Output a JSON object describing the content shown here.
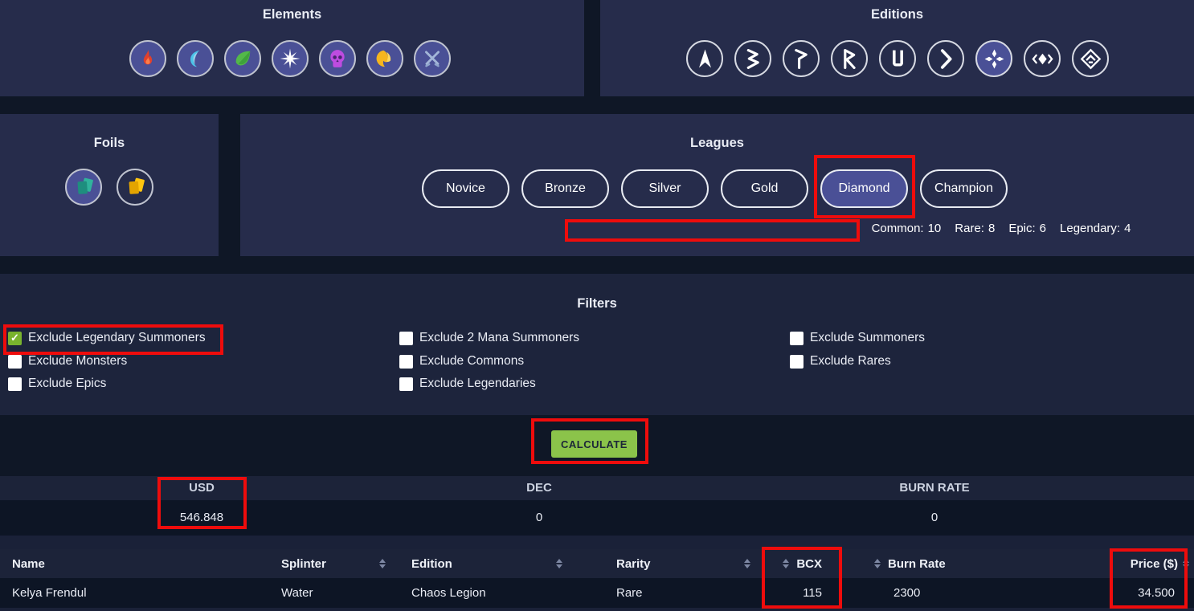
{
  "elements_panel": {
    "title": "Elements",
    "items": [
      {
        "name": "fire",
        "selected": true
      },
      {
        "name": "water",
        "selected": true
      },
      {
        "name": "earth",
        "selected": true
      },
      {
        "name": "life",
        "selected": true
      },
      {
        "name": "death",
        "selected": true
      },
      {
        "name": "dragon",
        "selected": true
      },
      {
        "name": "neutral",
        "selected": true
      }
    ]
  },
  "editions_panel": {
    "title": "Editions",
    "items": [
      {
        "name": "alpha",
        "selected": false
      },
      {
        "name": "beta",
        "selected": false
      },
      {
        "name": "promo",
        "selected": false
      },
      {
        "name": "reward",
        "selected": false
      },
      {
        "name": "untamed",
        "selected": false
      },
      {
        "name": "dice",
        "selected": false
      },
      {
        "name": "chaos-legion",
        "selected": true
      },
      {
        "name": "riftwatchers",
        "selected": false
      },
      {
        "name": "rebellion",
        "selected": false
      }
    ]
  },
  "foils_panel": {
    "title": "Foils",
    "items": [
      {
        "name": "regular-foil",
        "selected": true
      },
      {
        "name": "gold-foil",
        "selected": false
      }
    ]
  },
  "leagues_panel": {
    "title": "Leagues",
    "buttons": [
      "Novice",
      "Bronze",
      "Silver",
      "Gold",
      "Diamond",
      "Champion"
    ],
    "selected": "Diamond",
    "rarity_caps": [
      {
        "label": "Common:",
        "value": 10
      },
      {
        "label": "Rare:",
        "value": 8
      },
      {
        "label": "Epic:",
        "value": 6
      },
      {
        "label": "Legendary:",
        "value": 4
      }
    ]
  },
  "filters": {
    "title": "Filters",
    "columns": [
      [
        {
          "label": "Exclude Legendary Summoners",
          "checked": true
        },
        {
          "label": "Exclude Monsters",
          "checked": false
        },
        {
          "label": "Exclude Epics",
          "checked": false
        }
      ],
      [
        {
          "label": "Exclude 2 Mana Summoners",
          "checked": false
        },
        {
          "label": "Exclude Commons",
          "checked": false
        },
        {
          "label": "Exclude Legendaries",
          "checked": false
        }
      ],
      [
        {
          "label": "Exclude Summoners",
          "checked": false
        },
        {
          "label": "Exclude Rares",
          "checked": false
        }
      ]
    ]
  },
  "calculate": {
    "label": "CALCULATE"
  },
  "results": {
    "columns": [
      {
        "label": "USD",
        "value": "546.848"
      },
      {
        "label": "DEC",
        "value": "0"
      },
      {
        "label": "BURN RATE",
        "value": "0"
      }
    ]
  },
  "table": {
    "headers": [
      "Name",
      "Splinter",
      "Edition",
      "Rarity",
      "BCX",
      "Burn Rate",
      "Price ($)"
    ],
    "rows": [
      {
        "name": "Kelya Frendul",
        "splinter": "Water",
        "edition": "Chaos Legion",
        "rarity": "Rare",
        "bcx": "115",
        "burn_rate": "2300",
        "price": "34.500"
      }
    ]
  },
  "colors": {
    "selected_fill": "#4a5096",
    "annotation_red": "#ee0c0c",
    "calculate_green": "#8bc34a",
    "checked_green": "#79b32e",
    "panel_bg": "#262c4b",
    "dark_bg": "#0f1726"
  }
}
